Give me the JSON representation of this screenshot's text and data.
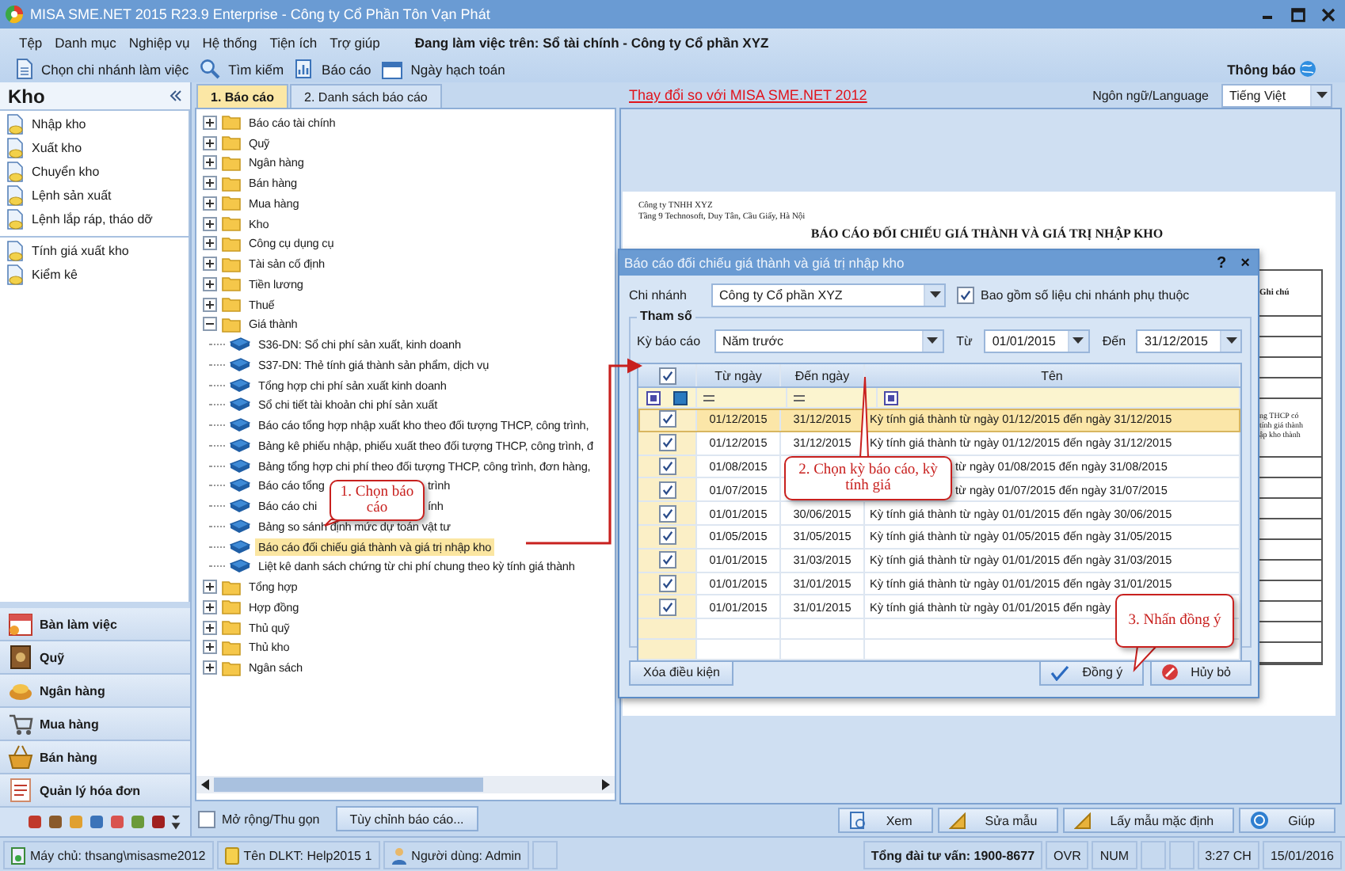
{
  "window": {
    "title": "MISA SME.NET 2015 R23.9 Enterprise - Công ty Cổ Phần Tôn Vạn Phát"
  },
  "menu": [
    "Tệp",
    "Danh mục",
    "Nghiệp vụ",
    "Hệ thống",
    "Tiện ích",
    "Trợ giúp"
  ],
  "working_on": "Đang làm việc trên: Sổ tài chính - Công ty Cổ phần XYZ",
  "notification": "Thông báo",
  "toolbar": [
    "Chọn chi nhánh làm việc",
    "Tìm kiếm",
    "Báo cáo",
    "Ngày hạch toán"
  ],
  "sidebar": {
    "title": "Kho",
    "groups": [
      [
        "Nhập kho",
        "Xuất kho",
        "Chuyển kho",
        "Lệnh sản xuất",
        "Lệnh lắp ráp, tháo dỡ"
      ],
      [
        "Tính giá xuất kho",
        "Kiểm kê"
      ]
    ]
  },
  "modules": [
    "Bàn làm việc",
    "Quỹ",
    "Ngân hàng",
    "Mua hàng",
    "Bán hàng",
    "Quản lý hóa đơn"
  ],
  "tabs": [
    {
      "label": "1. Báo cáo",
      "selected": true
    },
    {
      "label": "2. Danh sách báo cáo",
      "selected": false
    }
  ],
  "tree": [
    {
      "label": "Báo cáo tài chính",
      "expanded": false,
      "selected": false
    },
    {
      "label": "Quỹ",
      "expanded": false,
      "selected": false
    },
    {
      "label": "Ngân hàng",
      "expanded": false,
      "selected": false
    },
    {
      "label": "Bán hàng",
      "expanded": false,
      "selected": false
    },
    {
      "label": "Mua hàng",
      "expanded": false,
      "selected": false
    },
    {
      "label": "Kho",
      "expanded": false,
      "selected": false
    },
    {
      "label": "Công cụ dụng cụ",
      "expanded": false,
      "selected": false
    },
    {
      "label": "Tài sản cố định",
      "expanded": false,
      "selected": false
    },
    {
      "label": "Tiền lương",
      "expanded": false,
      "selected": false
    },
    {
      "label": "Thuế",
      "expanded": false,
      "selected": false
    },
    {
      "label": "Giá thành",
      "expanded": true,
      "selected": false,
      "children": [
        {
          "label": "S36-DN: Sổ chi phí sản xuất, kinh doanh",
          "selected": false
        },
        {
          "label": "S37-DN: Thẻ tính giá thành sản phẩm, dịch vụ",
          "selected": false
        },
        {
          "label": "Tổng hợp chi phí sản xuất kinh doanh",
          "selected": false
        },
        {
          "label": "Sổ chi tiết tài khoản chi phí sản xuất",
          "selected": false
        },
        {
          "label": "Báo cáo tổng hợp nhập xuất kho theo đối tượng THCP, công trình,",
          "selected": false
        },
        {
          "label": "Bảng kê phiếu nhập, phiếu xuất theo đối tượng THCP, công trình, đ",
          "selected": false
        },
        {
          "label": "Bảng tổng hợp chi phí theo đối tượng THCP, công trình, đơn hàng,",
          "selected": false
        },
        {
          "label": "Báo cáo tổng",
          "tail": "trình",
          "selected": false
        },
        {
          "label": "Báo cáo chi",
          "tail": "ính",
          "selected": false
        },
        {
          "label": "Bảng so sánh định mức dự toán vật tư",
          "selected": false
        },
        {
          "label": "Báo cáo đối chiếu giá thành và giá trị nhập kho",
          "selected": true
        },
        {
          "label": "Liệt kê danh sách chứng từ chi phí chung theo kỳ tính giá thành",
          "selected": false
        }
      ]
    },
    {
      "label": "Tổng hợp",
      "expanded": false,
      "selected": false
    },
    {
      "label": "Hợp đồng",
      "expanded": false,
      "selected": false
    },
    {
      "label": "Thủ quỹ",
      "expanded": false,
      "selected": false
    },
    {
      "label": "Thủ kho",
      "expanded": false,
      "selected": false
    },
    {
      "label": "Ngân sách",
      "expanded": false,
      "selected": false
    }
  ],
  "expand_toggle": {
    "label": "Mở rộng/Thu gọn",
    "checked": false
  },
  "customize_button": "Tùy chỉnh báo cáo...",
  "changes_link": "Thay đổi so với MISA SME.NET 2012",
  "language": {
    "label": "Ngôn ngữ/Language",
    "value": "Tiếng Việt"
  },
  "report_preview": {
    "company": "Công ty TNHH XYZ",
    "address": "Tầng 9 Technosoft, Duy Tân, Cầu Giấy, Hà Nội",
    "title": "BÁO CÁO ĐỐI CHIẾU GIÁ THÀNH VÀ GIÁ TRỊ NHẬP KHO",
    "column_heading": "Ghi chú",
    "note_lines": [
      "ng THCP có",
      "tính giá thành",
      "ập kho thành"
    ]
  },
  "dialog": {
    "title": "Báo cáo đối chiếu giá thành và giá trị nhập kho",
    "help": "?",
    "close": "×",
    "branch": {
      "label": "Chi nhánh",
      "value": "Công ty Cổ phần XYZ"
    },
    "include_dependent": {
      "label": "Bao gồm số liệu chi nhánh phụ thuộc",
      "checked": true
    },
    "group_title": "Tham số",
    "period": {
      "label": "Kỳ báo cáo",
      "value": "Năm trước"
    },
    "from": {
      "label": "Từ",
      "value": "01/01/2015"
    },
    "to": {
      "label": "Đến",
      "value": "31/12/2015"
    },
    "grid": {
      "all_checked": true,
      "columns": [
        "Từ ngày",
        "Đến ngày",
        "Tên"
      ],
      "rows": [
        {
          "checked": true,
          "selected": true,
          "from": "01/12/2015",
          "to": "31/12/2015",
          "name": "Kỳ tính giá thành từ ngày 01/12/2015 đến ngày 31/12/2015"
        },
        {
          "checked": true,
          "selected": false,
          "from": "01/12/2015",
          "to": "31/12/2015",
          "name": "Kỳ tính giá thành từ ngày 01/12/2015 đến ngày 31/12/2015"
        },
        {
          "checked": true,
          "selected": false,
          "from": "01/08/2015",
          "name": "từ ngày 01/08/2015 đến ngày 31/08/2015"
        },
        {
          "checked": true,
          "selected": false,
          "from": "01/07/2015",
          "name": "từ ngày 01/07/2015 đến ngày 31/07/2015"
        },
        {
          "checked": true,
          "selected": false,
          "from": "01/01/2015",
          "to": "30/06/2015",
          "name": "Kỳ tính giá thành từ ngày 01/01/2015 đến ngày 30/06/2015"
        },
        {
          "checked": true,
          "selected": false,
          "from": "01/05/2015",
          "to": "31/05/2015",
          "name": "Kỳ tính giá thành từ ngày 01/05/2015 đến ngày 31/05/2015"
        },
        {
          "checked": true,
          "selected": false,
          "from": "01/01/2015",
          "to": "31/03/2015",
          "name": "Kỳ tính giá thành từ ngày 01/01/2015 đến ngày 31/03/2015"
        },
        {
          "checked": true,
          "selected": false,
          "from": "01/01/2015",
          "to": "31/01/2015",
          "name": "Kỳ tính giá thành từ ngày 01/01/2015 đến ngày 31/01/2015"
        },
        {
          "checked": true,
          "selected": false,
          "from": "01/01/2015",
          "to": "31/01/2015",
          "name": "Kỳ tính giá thành từ ngày 01/01/2015 đến ngày"
        }
      ]
    },
    "clear_button": "Xóa điều kiện",
    "ok_button": "Đồng ý",
    "cancel_button": "Hủy bỏ"
  },
  "actions": [
    "Xem",
    "Sửa mẫu",
    "Lấy mẫu mặc định",
    "Giúp"
  ],
  "status_bar": {
    "server": "Máy chủ: thsang\\misasme2012",
    "database": "Tên DLKT: Help2015 1",
    "user": "Người dùng: Admin",
    "hotline": "Tổng đài tư vấn: 1900-8677",
    "indicators": [
      "OVR",
      "NUM"
    ],
    "time": "3:27 CH",
    "date": "15/01/2016"
  },
  "callouts": [
    "1. Chọn báo cáo",
    "2. Chọn kỳ báo cáo, kỳ tính giá",
    "3. Nhấn đồng ý"
  ]
}
